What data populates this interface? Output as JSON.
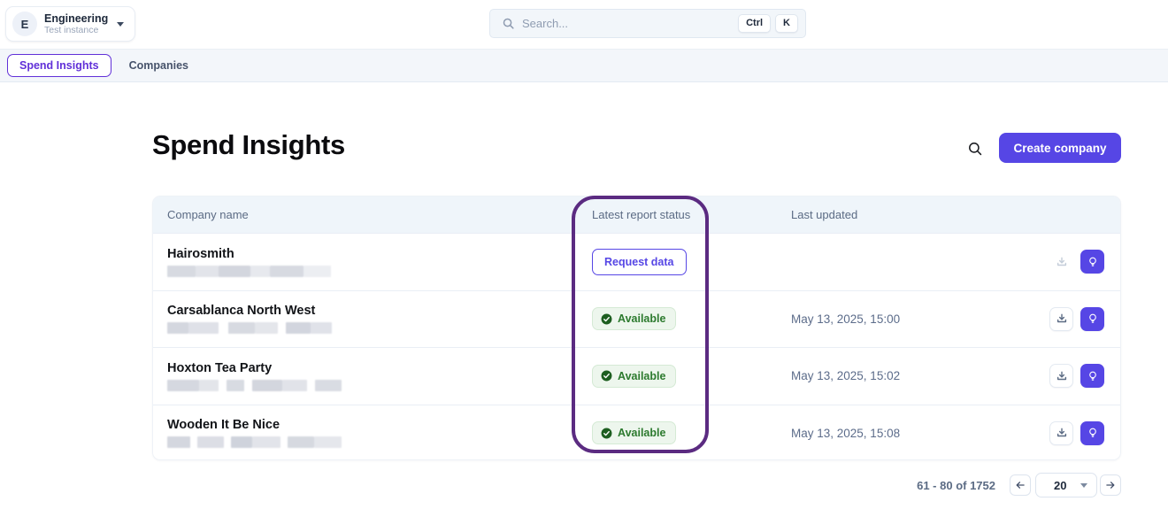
{
  "topbar": {
    "workspace": {
      "avatar_initial": "E",
      "name": "Engineering",
      "subtitle": "Test instance"
    },
    "search": {
      "placeholder": "Search...",
      "shortcut": {
        "ctrl": "Ctrl",
        "k": "K"
      }
    }
  },
  "nav": {
    "tabs": [
      {
        "label": "Spend Insights",
        "active": true
      },
      {
        "label": "Companies",
        "active": false
      }
    ]
  },
  "page": {
    "title": "Spend Insights",
    "create_button_label": "Create company"
  },
  "table": {
    "columns": {
      "company": "Company name",
      "status": "Latest report status",
      "updated": "Last updated"
    },
    "rows": [
      {
        "name": "Hairosmith",
        "status": "Request data",
        "status_type": "request",
        "last_updated": "",
        "download_enabled": false
      },
      {
        "name": "Carsablanca North West",
        "status": "Available",
        "status_type": "available",
        "last_updated": "May 13, 2025, 15:00",
        "download_enabled": true
      },
      {
        "name": "Hoxton Tea Party",
        "status": "Available",
        "status_type": "available",
        "last_updated": "May 13, 2025, 15:02",
        "download_enabled": true
      },
      {
        "name": "Wooden It Be Nice",
        "status": "Available",
        "status_type": "available",
        "last_updated": "May 13, 2025, 15:08",
        "download_enabled": true
      }
    ]
  },
  "pagination": {
    "range_text": "61 - 80 of 1752",
    "page_size": "20"
  },
  "annotation": {
    "purpose": "highlight around Latest report status column",
    "color": "#5b2b81"
  },
  "icons": {
    "search": "magnifier",
    "caret": "chevron-down",
    "download": "tray-arrow-down",
    "insights": "lightbulb",
    "available": "check-circle",
    "prev": "arrow-left",
    "next": "arrow-right"
  },
  "colors": {
    "primary": "#5646e5",
    "annotation": "#5b2b81",
    "available_text": "#2c7a2e",
    "available_bg": "#edf6ed",
    "header_bg": "#eff5fa"
  }
}
